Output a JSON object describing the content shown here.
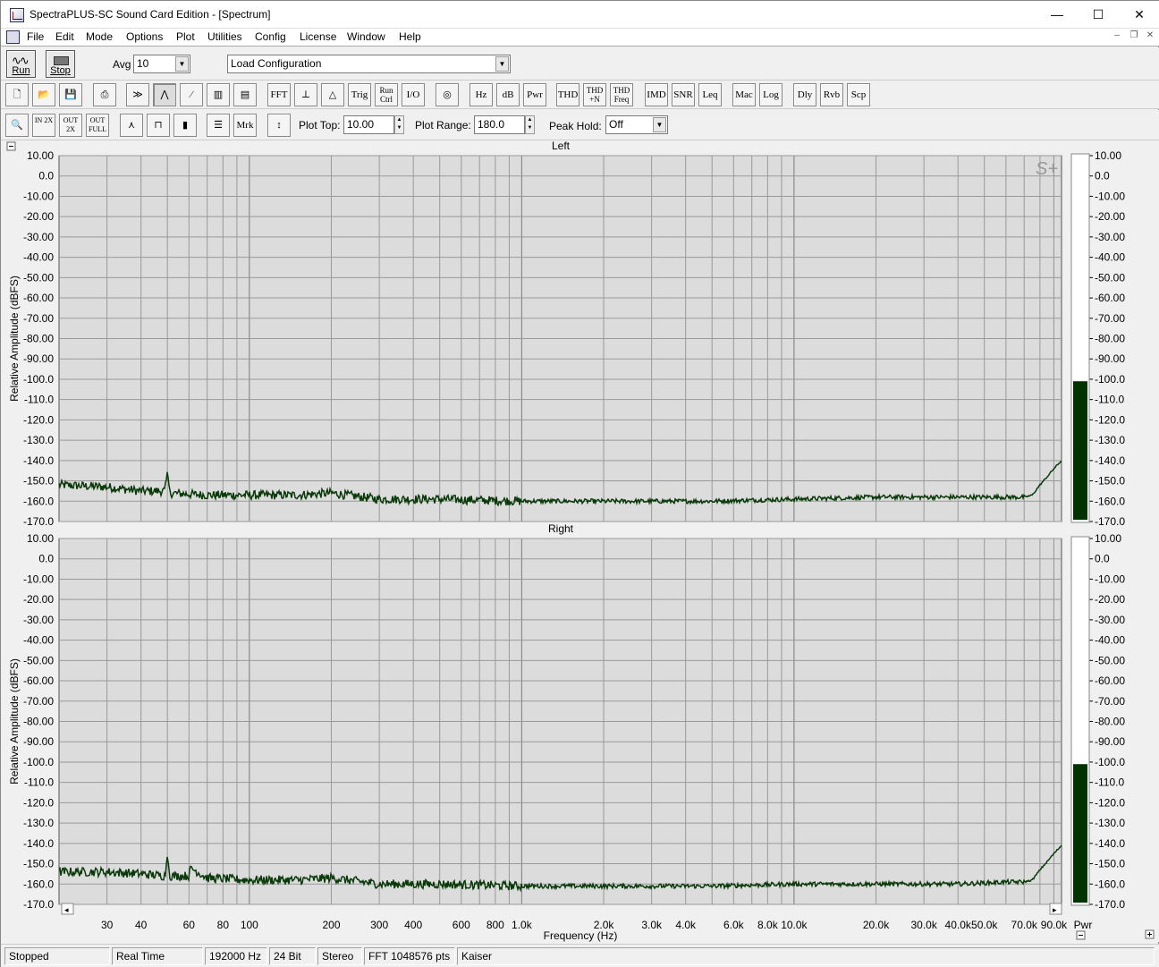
{
  "window": {
    "title": "SpectraPLUS-SC Sound Card Edition - [Spectrum]",
    "minimize_glyph": "—",
    "maximize_glyph": "☐",
    "close_glyph": "✕"
  },
  "menu": [
    "File",
    "Edit",
    "Mode",
    "Options",
    "Plot",
    "Utilities",
    "Config",
    "License",
    "Window",
    "Help"
  ],
  "mdi_controls": [
    "–",
    "❐",
    "✕"
  ],
  "toolbar1": {
    "run_label": "Run",
    "stop_label": "Stop",
    "avg_label": "Avg",
    "avg_value": "10",
    "config_value": "Load Configuration"
  },
  "toolbar2": {
    "buttons": [
      "FFT",
      "Trig",
      "Run Ctrl",
      "I/O",
      "Hz",
      "dB",
      "Pwr",
      "THD",
      "THD +N",
      "THD Freq",
      "IMD",
      "SNR",
      "Leq",
      "Mac",
      "Log",
      "Dly",
      "Rvb",
      "Scp"
    ]
  },
  "toolbar3": {
    "zoom_in_label": "IN 2X",
    "zoom_out_label": "OUT 2X",
    "zoom_full_label": "OUT FULL",
    "marker_label": "Mrk",
    "plot_top_label": "Plot Top:",
    "plot_top_value": "10.00",
    "plot_range_label": "Plot Range:",
    "plot_range_value": "180.0",
    "peak_hold_label": "Peak Hold:",
    "peak_hold_value": "Off"
  },
  "chart_data": [
    {
      "type": "line",
      "title": "Left",
      "xlabel": "Frequency (Hz)",
      "ylabel": "Relative Amplitude (dBFS)",
      "x_scale": "log",
      "xlim": [
        20,
        96000
      ],
      "ylim": [
        -170,
        10
      ],
      "y_ticks": [
        "10.00",
        "0.0",
        "-10.00",
        "-20.00",
        "-30.00",
        "-40.00",
        "-50.00",
        "-60.00",
        "-70.00",
        "-80.00",
        "-90.00",
        "-100.0",
        "-110.0",
        "-120.0",
        "-130.0",
        "-140.0",
        "-150.0",
        "-160.0",
        "-170.0"
      ],
      "color": "#0a3a0a",
      "grid": true,
      "series": [
        {
          "x": [
            20,
            30,
            40,
            49,
            50,
            51,
            70,
            100,
            150,
            200,
            300,
            500,
            1000,
            2000,
            5000,
            10000,
            20000,
            40000,
            60000,
            70000,
            75000,
            80000,
            85000,
            90000,
            96000
          ],
          "values": [
            -152,
            -153,
            -155,
            -155,
            -145,
            -156,
            -157,
            -157,
            -157,
            -156,
            -159,
            -159,
            -160,
            -160,
            -160,
            -159,
            -158,
            -158,
            -158,
            -158,
            -157,
            -152,
            -148,
            -144,
            -140
          ]
        }
      ],
      "power_meter": {
        "label": "Pwr",
        "value": -101
      }
    },
    {
      "type": "line",
      "title": "Right",
      "xlabel": "Frequency (Hz)",
      "ylabel": "Relative Amplitude (dBFS)",
      "x_scale": "log",
      "xlim": [
        20,
        96000
      ],
      "ylim": [
        -170,
        10
      ],
      "y_ticks": [
        "10.00",
        "0.0",
        "-10.00",
        "-20.00",
        "-30.00",
        "-40.00",
        "-50.00",
        "-60.00",
        "-70.00",
        "-80.00",
        "-90.00",
        "-100.0",
        "-110.0",
        "-120.0",
        "-130.0",
        "-140.0",
        "-150.0",
        "-160.0",
        "-170.0"
      ],
      "x_ticks": [
        "30",
        "40",
        "60",
        "80",
        "100",
        "200",
        "300",
        "400",
        "600",
        "800",
        "1.0k",
        "2.0k",
        "3.0k",
        "4.0k",
        "6.0k",
        "8.0k",
        "10.0k",
        "20.0k",
        "30.0k",
        "40.0k",
        "50.0k",
        "70.0k",
        "90.0k"
      ],
      "x_tick_values": [
        30,
        40,
        60,
        80,
        100,
        200,
        300,
        400,
        600,
        800,
        1000,
        2000,
        3000,
        4000,
        6000,
        8000,
        10000,
        20000,
        30000,
        40000,
        50000,
        70000,
        90000
      ],
      "color": "#0a3a0a",
      "grid": true,
      "series": [
        {
          "x": [
            20,
            30,
            40,
            49,
            50,
            51,
            60,
            61,
            70,
            100,
            150,
            200,
            300,
            500,
            1000,
            2000,
            5000,
            10000,
            20000,
            40000,
            60000,
            70000,
            75000,
            80000,
            85000,
            90000,
            96000
          ],
          "values": [
            -154,
            -154,
            -155,
            -156,
            -146,
            -156,
            -156,
            -152,
            -157,
            -158,
            -158,
            -157,
            -160,
            -160,
            -161,
            -161,
            -161,
            -160,
            -160,
            -160,
            -159,
            -159,
            -158,
            -153,
            -149,
            -145,
            -141
          ]
        }
      ],
      "power_meter": {
        "label": "Pwr",
        "value": -101
      }
    }
  ],
  "status": [
    "Stopped",
    "Real Time",
    "192000 Hz",
    "24 Bit",
    "Stereo",
    "FFT 1048576 pts",
    "Kaiser"
  ]
}
